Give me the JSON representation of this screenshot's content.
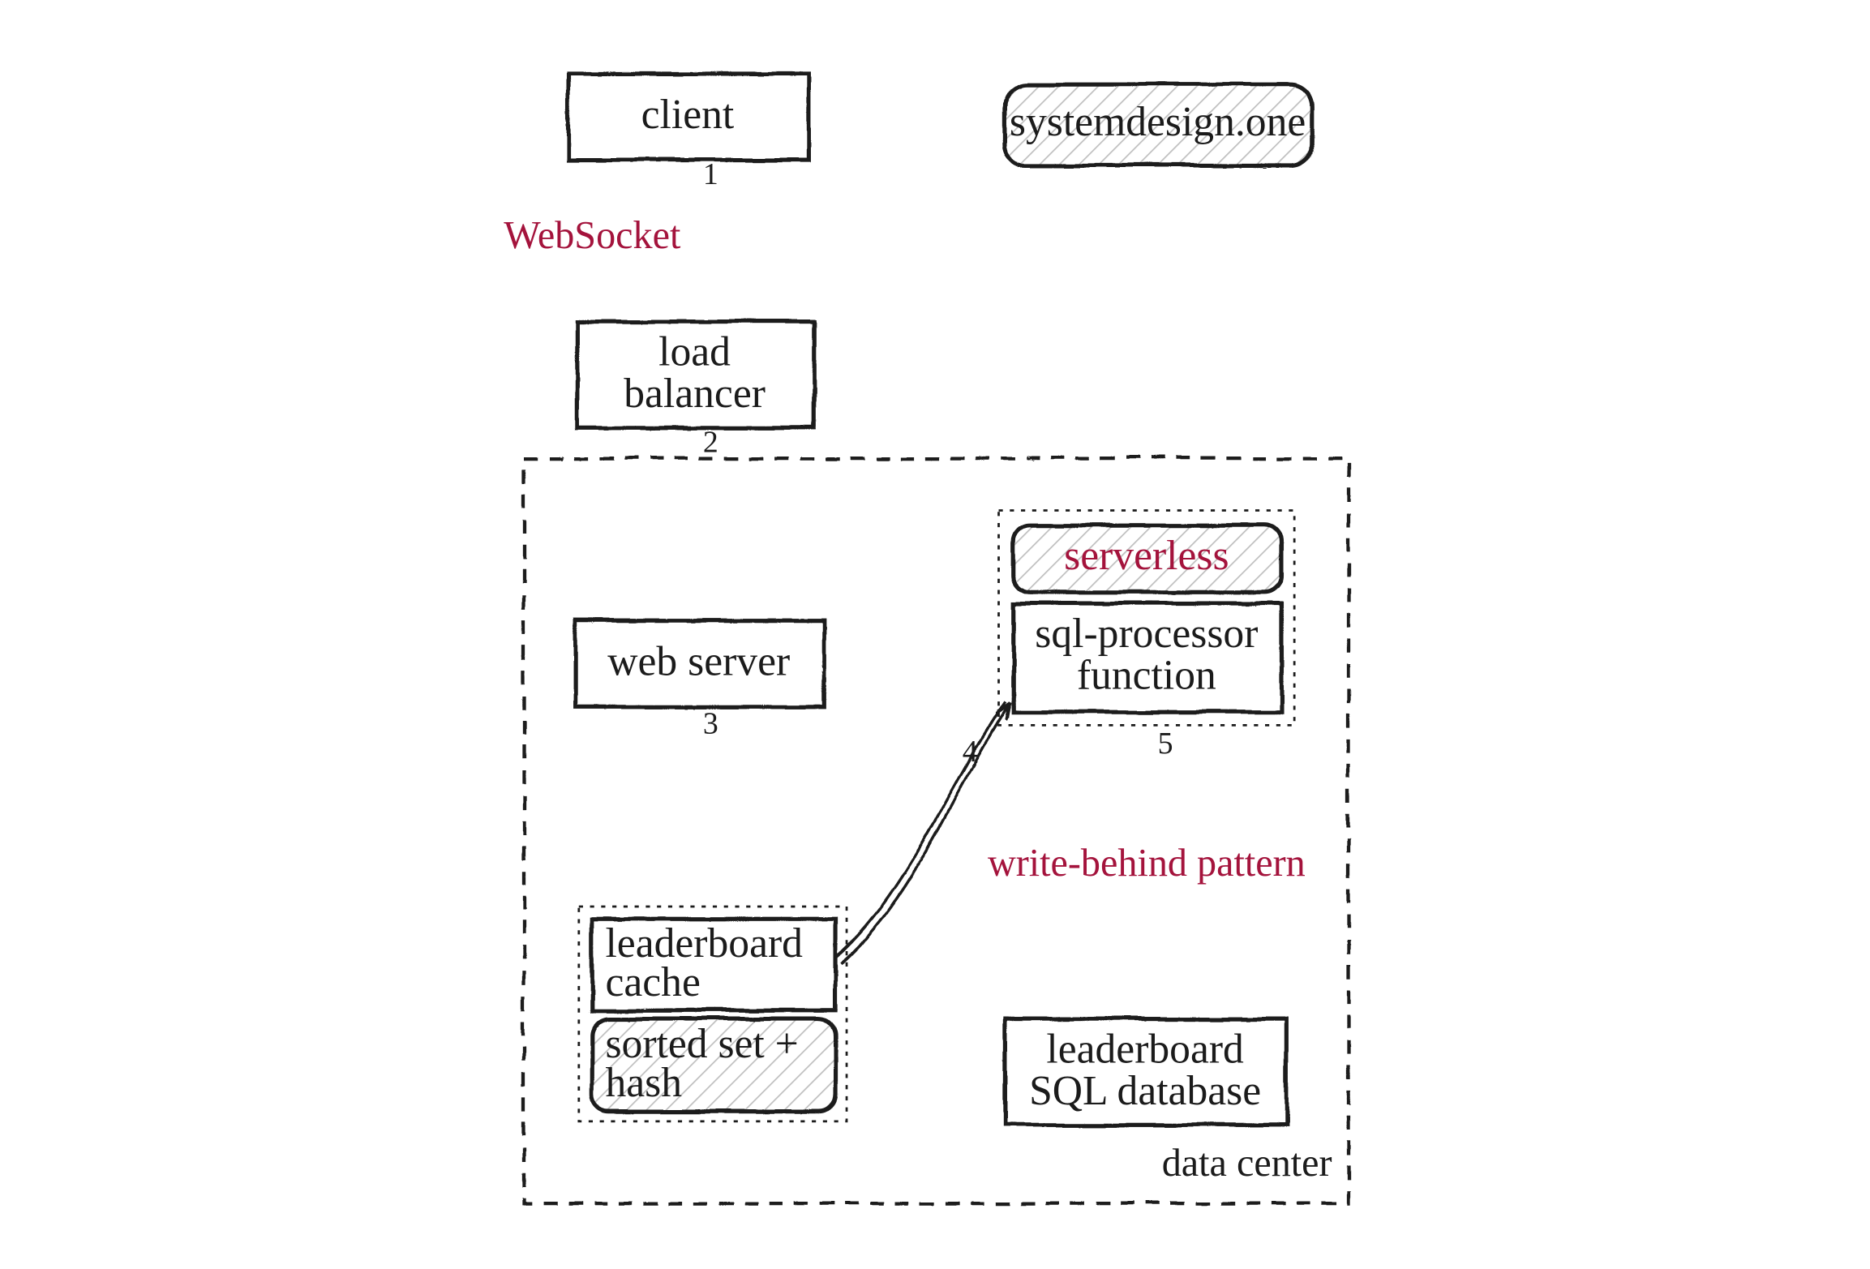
{
  "watermark": "systemdesign.one",
  "nodes": {
    "client": "client",
    "loadBalancer1": "load",
    "loadBalancer2": "balancer",
    "webServer": "web server",
    "serverlessTitle": "serverless",
    "sqlProcessor1": "sql-processor",
    "sqlProcessor2": "function",
    "cache1": "leaderboard",
    "cache2": "cache",
    "sortedSet1": "sorted set +",
    "sortedSet2": "hash",
    "db1": "leaderboard",
    "db2": "SQL database"
  },
  "edgeLabels": {
    "websocket": "WebSocket",
    "writeBehind": "write-behind pattern"
  },
  "edgeNumbers": {
    "e1": "1",
    "e2": "2",
    "e3": "3",
    "e4": "4",
    "e5": "5"
  },
  "regions": {
    "dataCenter": "data center"
  }
}
